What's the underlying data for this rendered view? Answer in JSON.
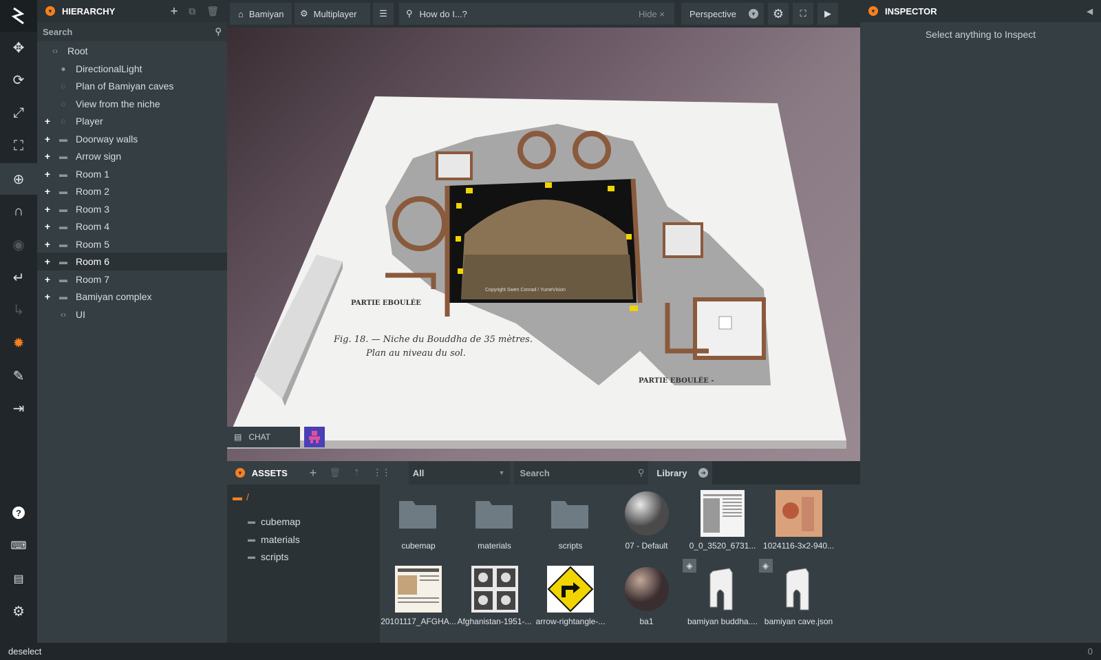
{
  "toolbar": {
    "tools": [
      "move-tool",
      "rotate-tool",
      "scale-tool",
      "resize-tool",
      "world-tool",
      "magnet-tool",
      "view-tool",
      "undo-tool",
      "redo-tool",
      "light-tool",
      "edit-tool",
      "export-tool"
    ],
    "bottom": [
      "help",
      "keyboard",
      "chat",
      "settings"
    ]
  },
  "hierarchy": {
    "title": "HIERARCHY",
    "search_placeholder": "Search",
    "items": [
      {
        "label": "Root",
        "level": 0,
        "expand": "",
        "icon": "code"
      },
      {
        "label": "DirectionalLight",
        "level": 1,
        "expand": "",
        "icon": "light"
      },
      {
        "label": "Plan of Bamiyan caves",
        "level": 1,
        "expand": "",
        "icon": "entity"
      },
      {
        "label": "View from the niche",
        "level": 1,
        "expand": "",
        "icon": "entity"
      },
      {
        "label": "Player",
        "level": 1,
        "expand": "+",
        "icon": "entity"
      },
      {
        "label": "Doorway walls",
        "level": 1,
        "expand": "+",
        "icon": "folder"
      },
      {
        "label": "Arrow sign",
        "level": 1,
        "expand": "+",
        "icon": "folder"
      },
      {
        "label": "Room 1",
        "level": 1,
        "expand": "+",
        "icon": "folder"
      },
      {
        "label": "Room 2",
        "level": 1,
        "expand": "+",
        "icon": "folder"
      },
      {
        "label": "Room 3",
        "level": 1,
        "expand": "+",
        "icon": "folder"
      },
      {
        "label": "Room 4",
        "level": 1,
        "expand": "+",
        "icon": "folder"
      },
      {
        "label": "Room 5",
        "level": 1,
        "expand": "+",
        "icon": "folder"
      },
      {
        "label": "Room 6",
        "level": 1,
        "expand": "+",
        "icon": "folder",
        "selected": true
      },
      {
        "label": "Room 7",
        "level": 1,
        "expand": "+",
        "icon": "folder"
      },
      {
        "label": "Bamiyan complex",
        "level": 1,
        "expand": "+",
        "icon": "folder"
      },
      {
        "label": "UI",
        "level": 1,
        "expand": "",
        "icon": "code"
      }
    ]
  },
  "topbar": {
    "project": "Bamiyan",
    "multiplayer": "Multiplayer",
    "search_placeholder": "How do I...?",
    "hide": "Hide",
    "camera": "Perspective"
  },
  "viewport": {
    "plan_caption_1": "Fig. 18. — Niche du Bouddha de 35 mètres.",
    "plan_caption_2": "Plan au niveau du sol.",
    "partie_1": "PARTIE EBOULÉE",
    "partie_2": "PARTIE EBOULÉE -",
    "copyright": "Copyright Swen Conrad / YumeVision"
  },
  "chat": {
    "label": "CHAT"
  },
  "inspector": {
    "title": "INSPECTOR",
    "empty_message": "Select anything to Inspect"
  },
  "assets": {
    "title": "ASSETS",
    "filter": "All",
    "search_placeholder": "Search",
    "library": "Library",
    "root": "/",
    "folders": [
      "cubemap",
      "materials",
      "scripts"
    ],
    "items": [
      {
        "label": "cubemap",
        "kind": "folder"
      },
      {
        "label": "materials",
        "kind": "folder"
      },
      {
        "label": "scripts",
        "kind": "folder"
      },
      {
        "label": "07 - Default",
        "kind": "sphere-grey"
      },
      {
        "label": "0_0_3520_6731...",
        "kind": "document"
      },
      {
        "label": "1024116-3x2-940...",
        "kind": "painting"
      },
      {
        "label": "20101117_AFGHA...",
        "kind": "newspaper"
      },
      {
        "label": "Afghanistan-1951-...",
        "kind": "stamps"
      },
      {
        "label": "arrow-rightangle-...",
        "kind": "sign"
      },
      {
        "label": "ba1",
        "kind": "sphere-stone"
      },
      {
        "label": "bamiyan buddha....",
        "kind": "model"
      },
      {
        "label": "bamiyan cave.json",
        "kind": "model"
      }
    ]
  },
  "status": {
    "text": "deselect",
    "right": "0"
  },
  "colors": {
    "accent": "#f7801e",
    "panel": "#353e43",
    "dark": "#2b3236"
  }
}
